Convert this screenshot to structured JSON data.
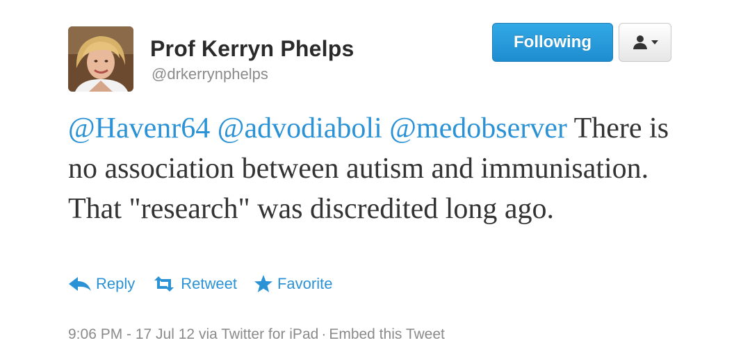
{
  "user": {
    "name": "Prof Kerryn Phelps",
    "handle": "@drkerrynphelps",
    "avatar_icon": "profile-photo"
  },
  "header_buttons": {
    "follow_label": "Following",
    "follow_color": "#2a9ee0",
    "user_menu_icon": "user-dropdown-icon"
  },
  "tweet": {
    "mentions": [
      "@Havenr64",
      "@advodiaboli",
      "@medobserver"
    ],
    "body": "There is no association between autism and immunisation. That \"research\" was discredited long ago."
  },
  "actions": {
    "reply": "Reply",
    "retweet": "Retweet",
    "favorite": "Favorite",
    "link_color": "#2b92d6"
  },
  "meta": {
    "timestamp": "9:06 PM - 17 Jul 12",
    "via": "via Twitter for iPad",
    "separator": "·",
    "embed": "Embed this Tweet"
  }
}
